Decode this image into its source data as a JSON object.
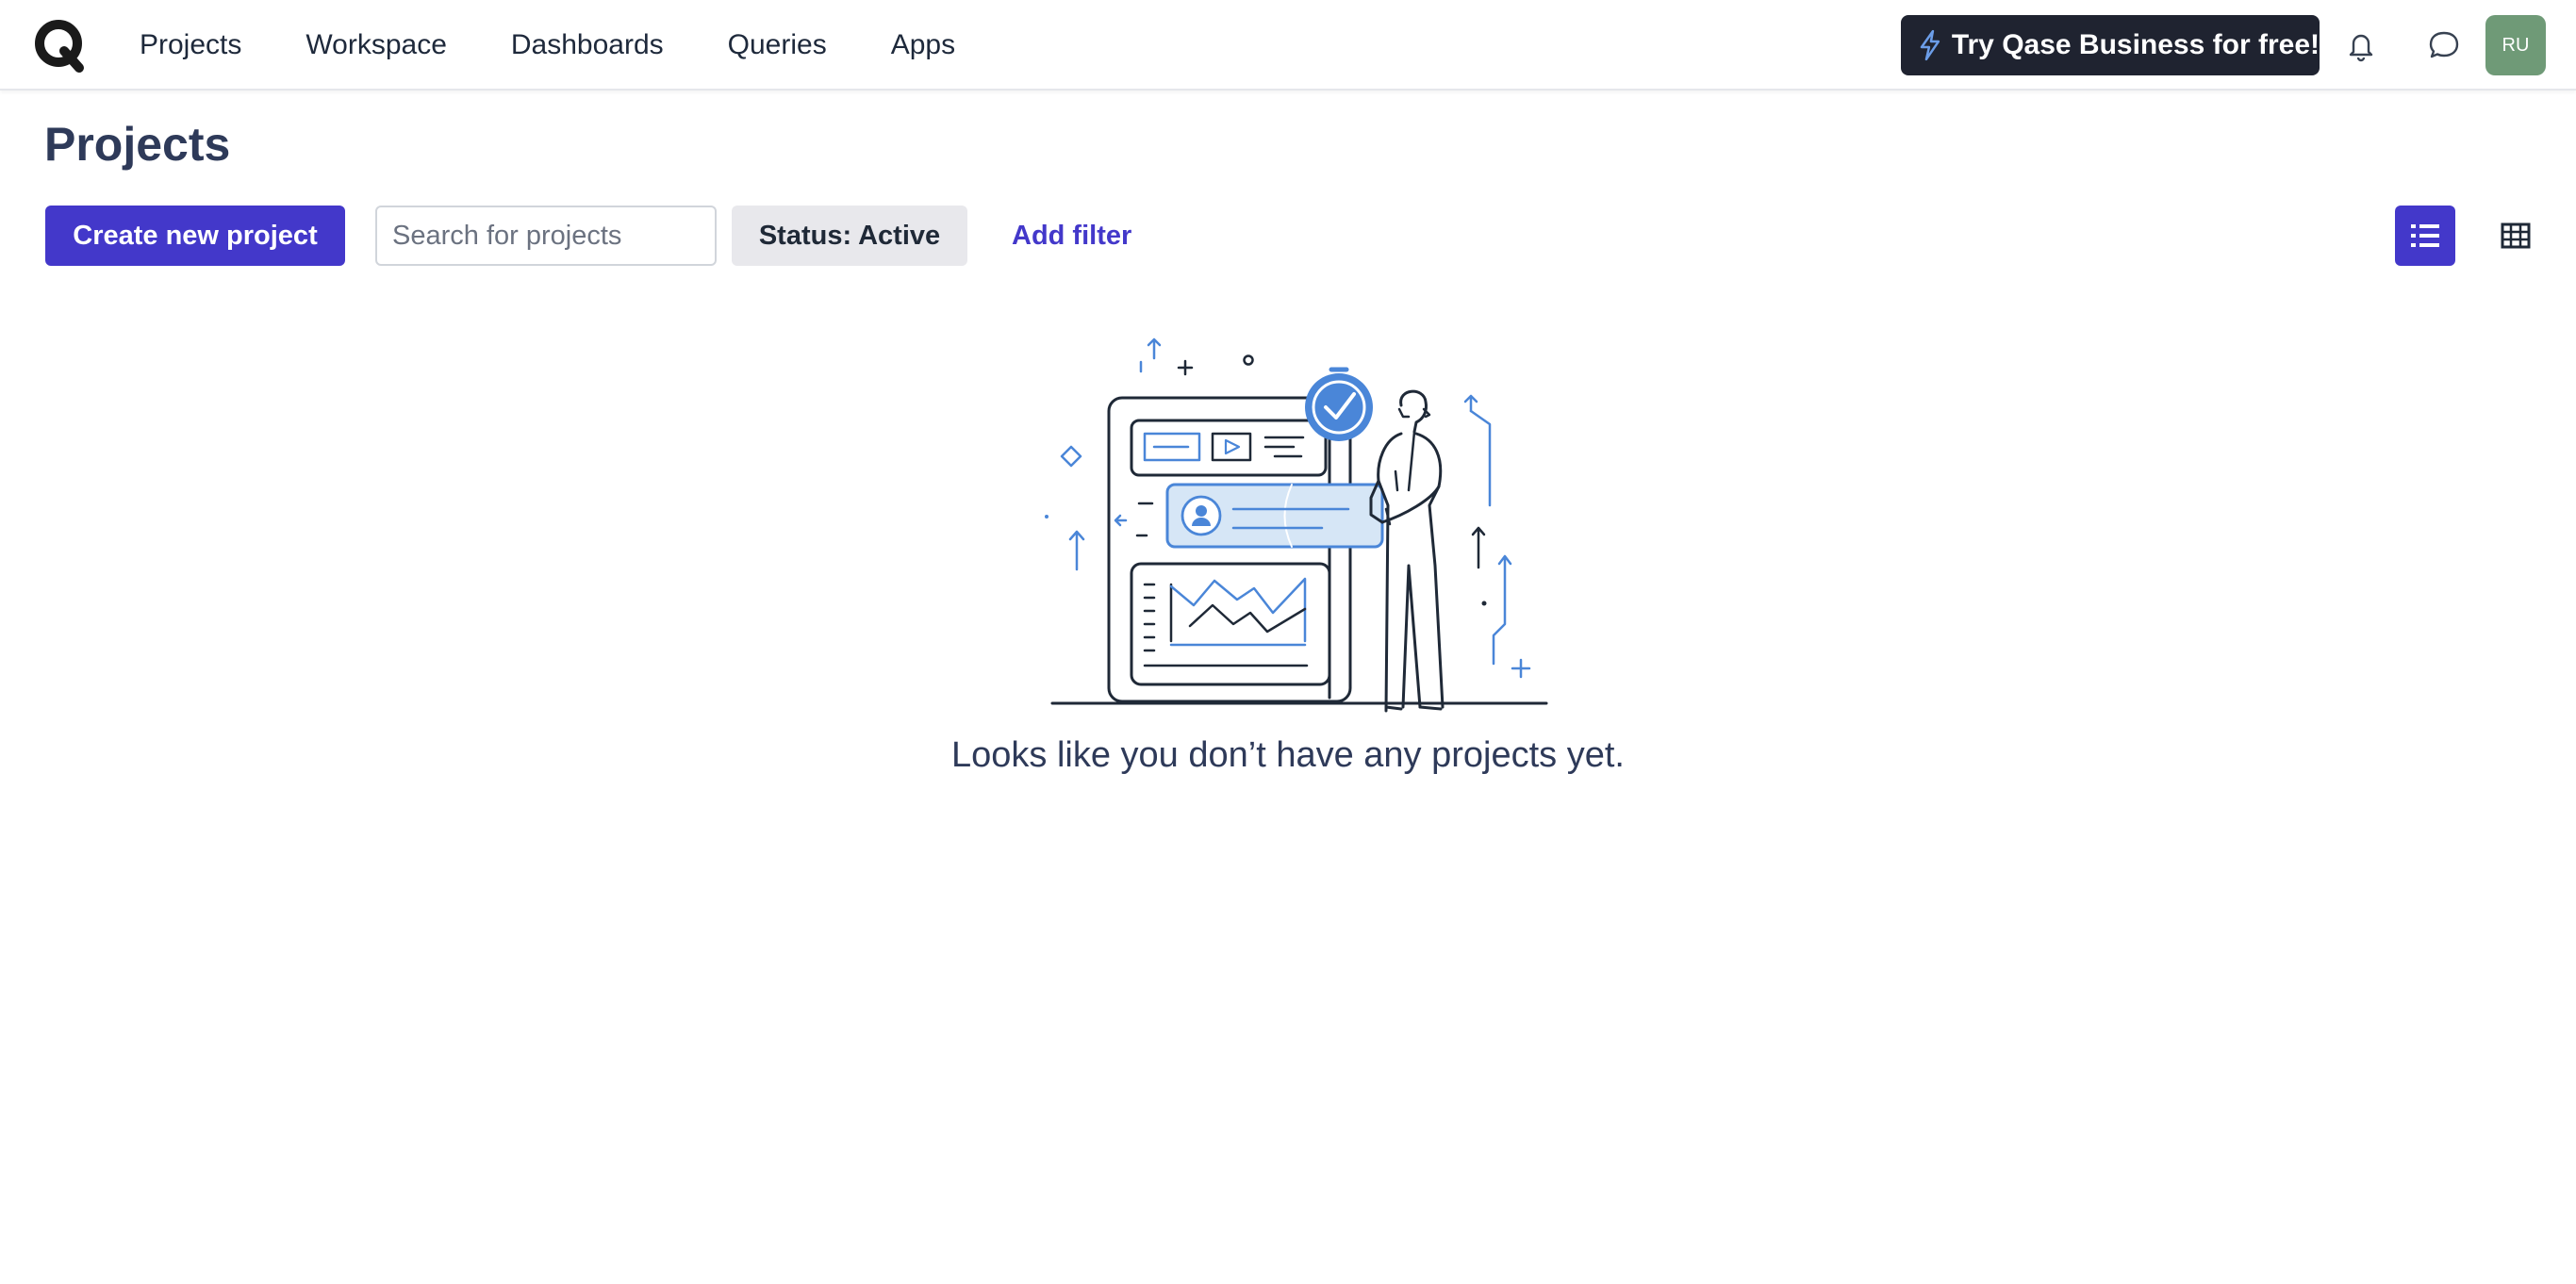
{
  "header": {
    "logo_icon": "qase-logo-icon",
    "nav": [
      {
        "label": "Projects"
      },
      {
        "label": "Workspace"
      },
      {
        "label": "Dashboards"
      },
      {
        "label": "Queries"
      },
      {
        "label": "Apps"
      }
    ],
    "promo_label": "Try Qase Business for free!",
    "promo_icon": "lightning-bolt-icon",
    "notifications_icon": "bell-icon",
    "messages_icon": "chat-bubble-icon",
    "avatar_initials": "RU"
  },
  "page": {
    "title": "Projects",
    "create_button_label": "Create new project",
    "search_placeholder": "Search for projects",
    "status_filter_label": "Status: Active",
    "add_filter_label": "Add filter",
    "view_toggle": {
      "active": "list",
      "list_icon": "list-view-icon",
      "grid_icon": "grid-view-icon"
    }
  },
  "empty_state": {
    "illustration": "person-with-dashboard-illustration",
    "message": "Looks like you don’t have any projects yet."
  },
  "colors": {
    "primary": "#4338ca",
    "promo_bg": "#1f2330",
    "avatar_bg": "#6f9a77",
    "title_text": "#2e3a59",
    "illustration_blue": "#4a86d8"
  }
}
